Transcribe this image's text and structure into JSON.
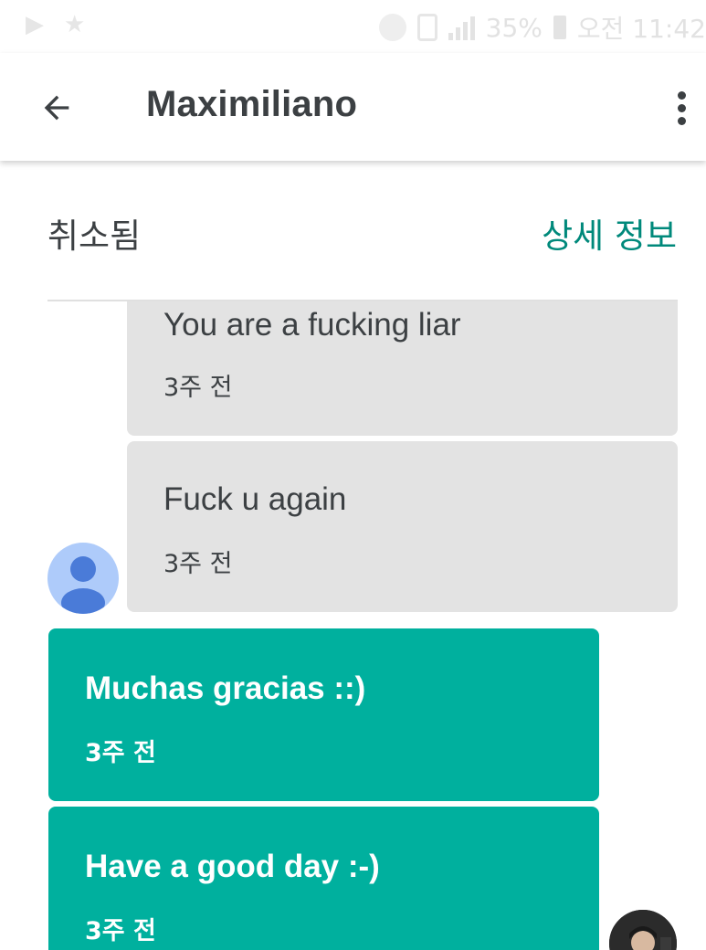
{
  "status_bar": {
    "battery_percent": "35%",
    "time": "오전 11:42"
  },
  "app_bar": {
    "title": "Maximiliano",
    "back_icon": "arrow-back-icon",
    "more_icon": "more-vert-icon"
  },
  "sub_header": {
    "status": "취소됨",
    "details_link": "상세 정보"
  },
  "messages": [
    {
      "direction": "incoming",
      "text": "You are a fucking liar",
      "time": "3주 전"
    },
    {
      "direction": "incoming",
      "text": "Fuck u again",
      "time": "3주 전"
    },
    {
      "direction": "outgoing",
      "text": "Muchas gracias ::)",
      "time": "3주 전"
    },
    {
      "direction": "outgoing",
      "text": "Have a good day :-)",
      "time": "3주 전"
    }
  ],
  "colors": {
    "accent": "#00897b",
    "outgoing_bubble": "#00b09e",
    "incoming_bubble": "#e3e3e3",
    "contact_avatar_bg": "#aecbfa",
    "contact_avatar_fg": "#4a7bd8"
  }
}
